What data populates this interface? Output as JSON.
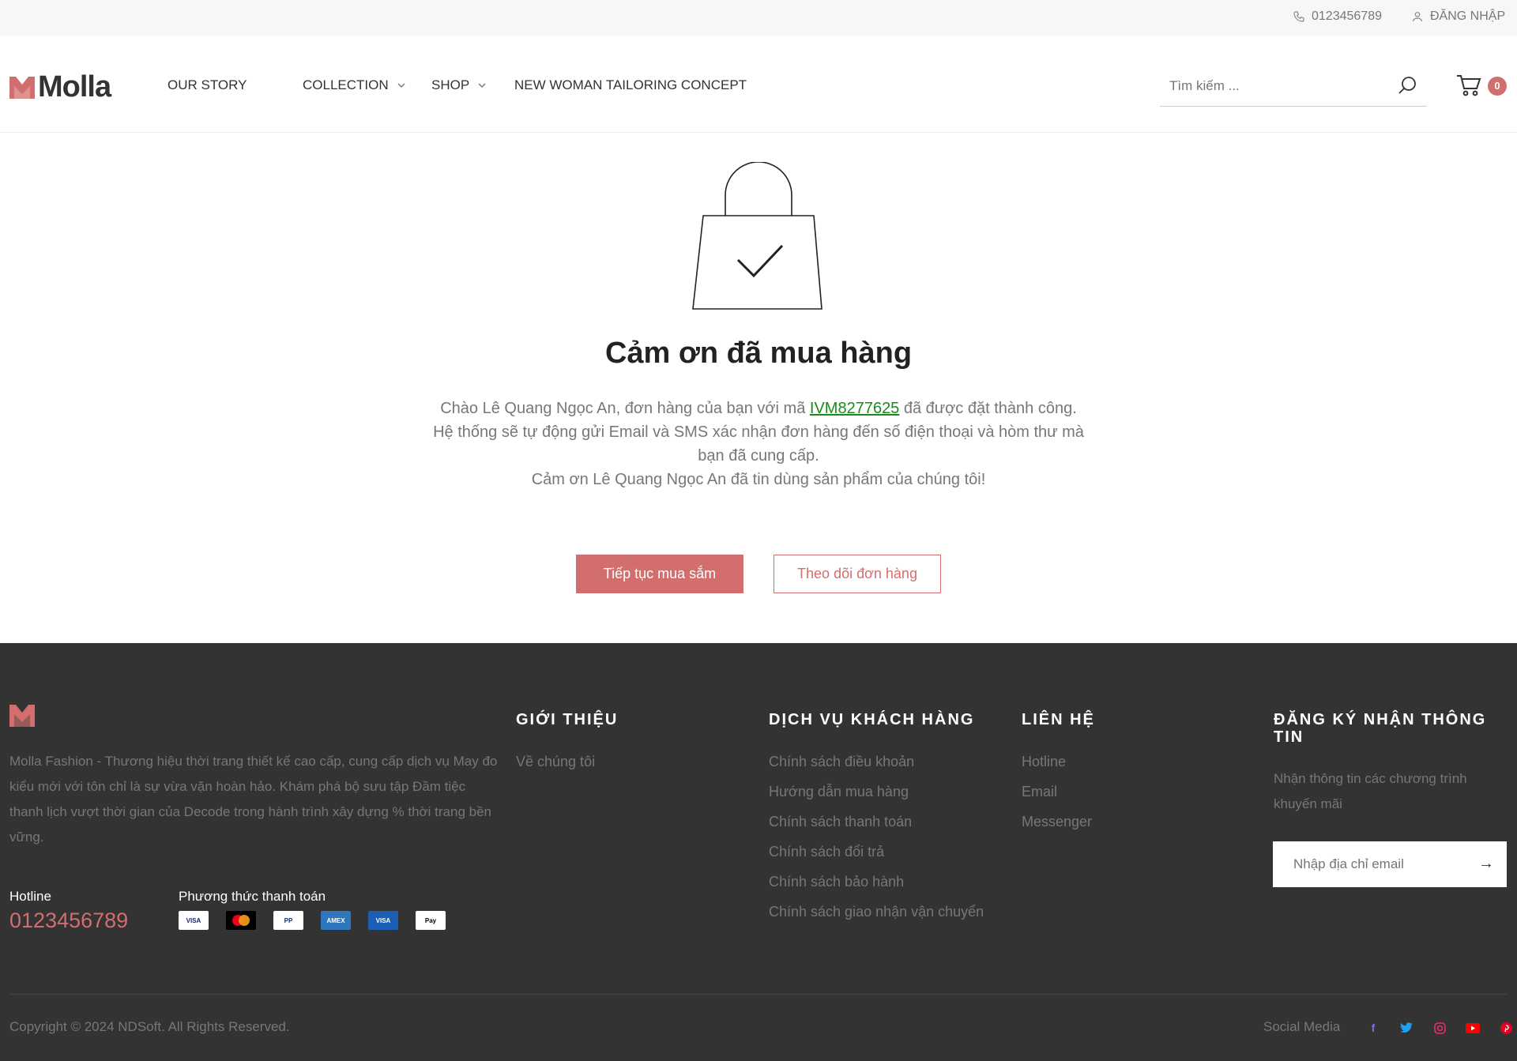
{
  "topbar": {
    "phone": "0123456789",
    "login": "ĐĂNG NHẬP"
  },
  "header": {
    "logo": "Molla",
    "nav": [
      {
        "label": "OUR STORY",
        "dropdown": false
      },
      {
        "label": "COLLECTION",
        "dropdown": true
      },
      {
        "label": "SHOP",
        "dropdown": true
      },
      {
        "label": "NEW WOMAN TAILORING CONCEPT",
        "dropdown": false
      }
    ],
    "search_placeholder": "Tìm kiếm ...",
    "cart_count": "0"
  },
  "main": {
    "title": "Cảm ơn đã mua hàng",
    "line1_prefix": "Chào Lê Quang Ngọc An, đơn hàng của bạn với mã ",
    "order_code": "IVM8277625",
    "line1_suffix": " đã được đặt thành công.",
    "line2": "Hệ thống sẽ tự động gửi Email và SMS xác nhận đơn hàng đến số điện thoại và hòm thư mà bạn đã cung cấp.",
    "line3": "Cảm ơn Lê Quang Ngọc An đã tin dùng sản phẩm của chúng tôi!",
    "continue_button": "Tiếp tục mua sắm",
    "track_button": "Theo dõi đơn hàng"
  },
  "footer": {
    "about": "Molla Fashion - Thương hiệu thời trang thiết kế cao cấp, cung cấp dịch vụ May đo kiểu mới với tôn chỉ là sự vừa vặn hoàn hảo. Khám phá bộ sưu tập Đầm tiệc thanh lịch vượt thời gian của Decode trong hành trình xây dựng % thời trang bền vững.",
    "hotline_label": "Hotline",
    "hotline_value": "0123456789",
    "payment_label": "Phương thức thanh toán",
    "payments": [
      "VISA",
      "Mastercard",
      "PayPal",
      "American Express",
      "VISA Electron",
      "Apple Pay"
    ],
    "col_intro": {
      "title": "GIỚI THIỆU",
      "links": [
        "Về chúng tôi"
      ]
    },
    "col_service": {
      "title": "DỊCH VỤ KHÁCH HÀNG",
      "links": [
        "Chính sách điều khoản",
        "Hướng dẫn mua hàng",
        "Chính sách thanh toán",
        "Chính sách đổi trả",
        "Chính sách bảo hành",
        "Chính sách giao nhận vận chuyển"
      ]
    },
    "col_contact": {
      "title": "LIÊN HỆ",
      "links": [
        "Hotline",
        "Email",
        "Messenger"
      ]
    },
    "col_newsletter": {
      "title": "ĐĂNG KÝ NHẬN THÔNG TIN",
      "text": "Nhận thông tin các chương trình khuyến mãi",
      "email_placeholder": "Nhập địa chỉ email"
    },
    "copyright": "Copyright © 2024 NDSoft. All Rights Reserved.",
    "social_label": "Social Media",
    "social": [
      "facebook",
      "twitter",
      "instagram",
      "youtube",
      "pinterest"
    ]
  },
  "colors": {
    "accent": "#d26e6e",
    "footer_bg": "#333333",
    "order_code": "#1a8a1a"
  }
}
